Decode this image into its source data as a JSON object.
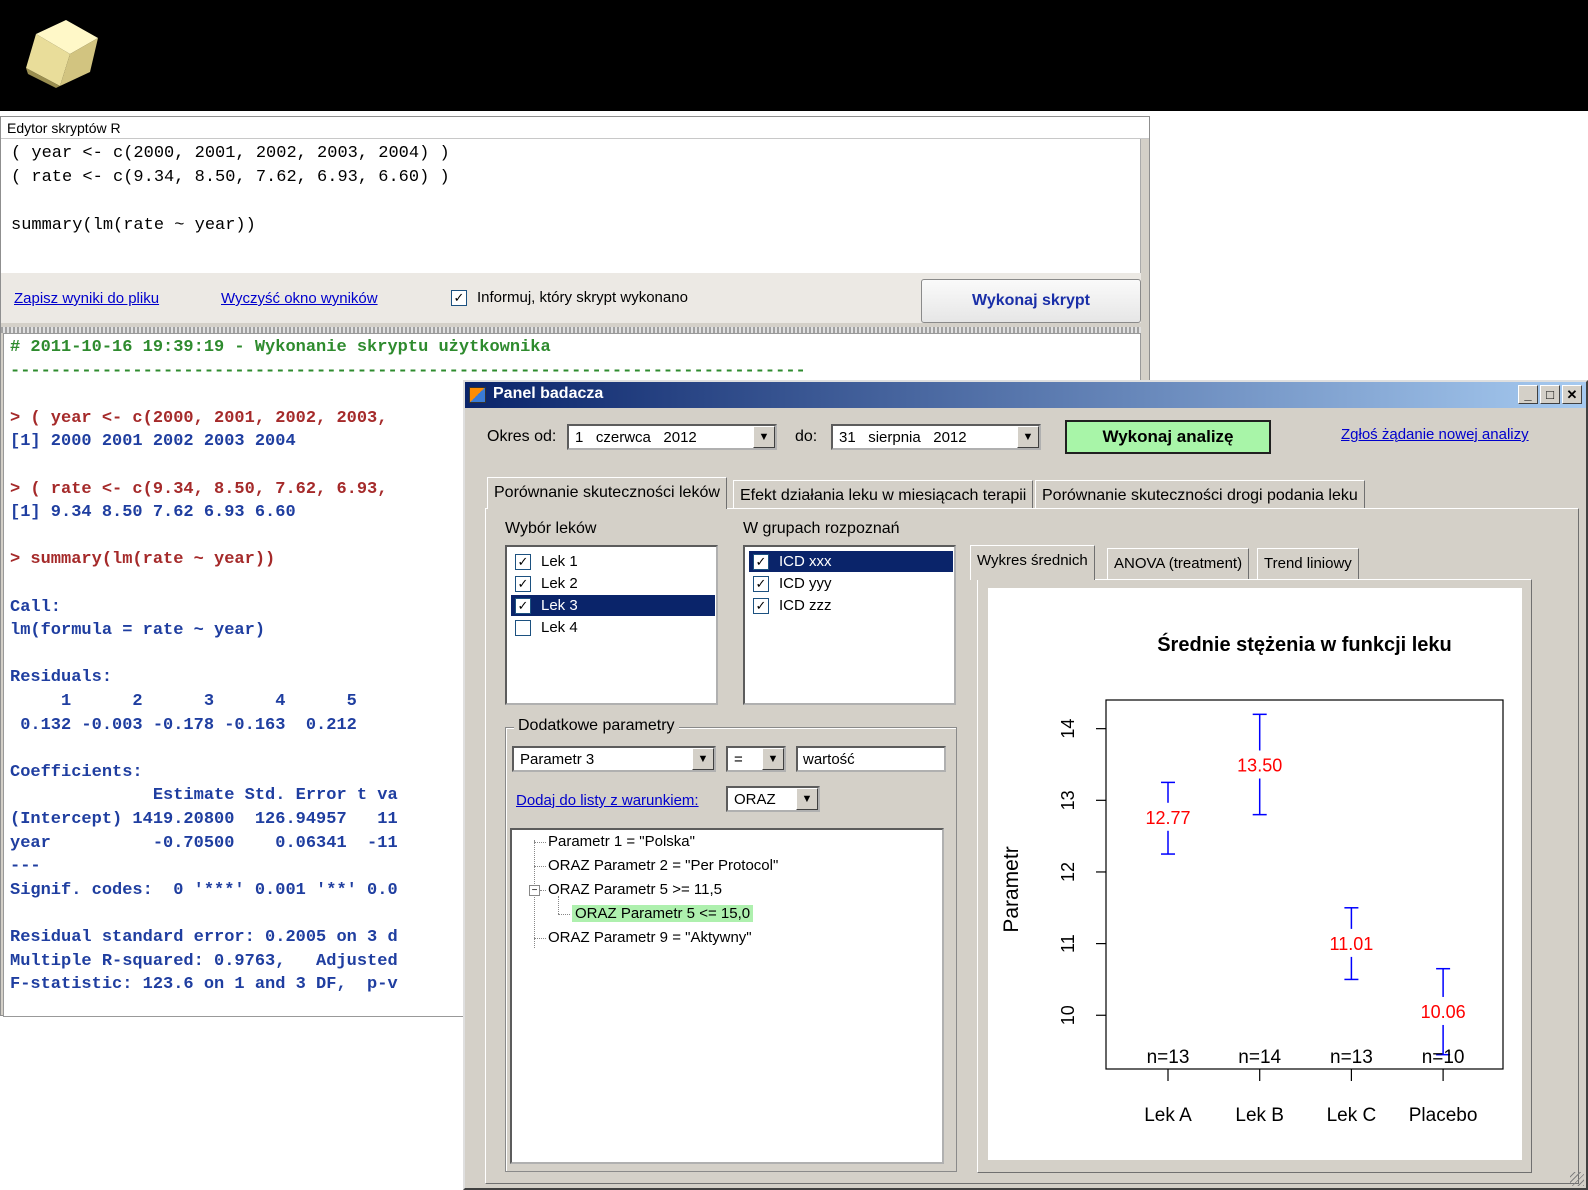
{
  "editor": {
    "title": "Edytor skryptów R",
    "code_lines": [
      "( year <- c(2000, 2001, 2002, 2003, 2004) )",
      "( rate <- c(9.34, 8.50, 7.62, 6.93, 6.60) )",
      "",
      "summary(lm(rate ~ year))"
    ],
    "save_link": "Zapisz wyniki do pliku",
    "clear_link": "Wyczyść okno wyników",
    "inform_checkbox": {
      "label": "Informuj, który skrypt wykonano",
      "checked": true
    },
    "run_button": "Wykonaj skrypt",
    "output_lines": [
      {
        "text": "# 2011-10-16 19:39:19 - Wykonanie skryptu użytkownika",
        "color": "green"
      },
      {
        "text": "------------------------------------------------------------------------------",
        "color": "green"
      },
      {
        "text": "",
        "color": "blue"
      },
      {
        "text": "> ( year <- c(2000, 2001, 2002, 2003,",
        "color": "red"
      },
      {
        "text": "[1] 2000 2001 2002 2003 2004",
        "color": "blue"
      },
      {
        "text": "",
        "color": "blue"
      },
      {
        "text": "> ( rate <- c(9.34, 8.50, 7.62, 6.93,",
        "color": "red"
      },
      {
        "text": "[1] 9.34 8.50 7.62 6.93 6.60",
        "color": "blue"
      },
      {
        "text": "",
        "color": "blue"
      },
      {
        "text": "> summary(lm(rate ~ year))",
        "color": "red"
      },
      {
        "text": "",
        "color": "blue"
      },
      {
        "text": "Call:",
        "color": "blue"
      },
      {
        "text": "lm(formula = rate ~ year)",
        "color": "blue"
      },
      {
        "text": "",
        "color": "blue"
      },
      {
        "text": "Residuals:",
        "color": "blue"
      },
      {
        "text": "     1      2      3      4      5",
        "color": "blue"
      },
      {
        "text": " 0.132 -0.003 -0.178 -0.163  0.212",
        "color": "blue"
      },
      {
        "text": "",
        "color": "blue"
      },
      {
        "text": "Coefficients:",
        "color": "blue"
      },
      {
        "text": "              Estimate Std. Error t va",
        "color": "blue"
      },
      {
        "text": "(Intercept) 1419.20800  126.94957   11",
        "color": "blue"
      },
      {
        "text": "year          -0.70500    0.06341  -11",
        "color": "blue"
      },
      {
        "text": "---",
        "color": "blue"
      },
      {
        "text": "Signif. codes:  0 '***' 0.001 '**' 0.0",
        "color": "blue"
      },
      {
        "text": "",
        "color": "blue"
      },
      {
        "text": "Residual standard error: 0.2005 on 3 d",
        "color": "blue"
      },
      {
        "text": "Multiple R-squared: 0.9763,   Adjusted",
        "color": "blue"
      },
      {
        "text": "F-statistic: 123.6 on 1 and 3 DF,  p-v",
        "color": "blue"
      }
    ]
  },
  "panel": {
    "title": "Panel badacza",
    "window_buttons": {
      "minimize": "_",
      "maximize": "□",
      "close": "✕"
    },
    "period_from_label": "Okres od:",
    "period_from": {
      "day": "1",
      "month": "czerwca",
      "year": "2012"
    },
    "period_to_label": "do:",
    "period_to": {
      "day": "31",
      "month": "sierpnia",
      "year": "2012"
    },
    "analyze_button": "Wykonaj analizę",
    "request_link": "Zgłoś żądanie nowej analizy",
    "tabs": [
      "Porównanie skuteczności leków",
      "Efekt działania leku w miesiącach terapii",
      "Porównanie skuteczności drogi podania leku"
    ],
    "drug_selection_label": "Wybór leków",
    "drugs": [
      {
        "label": "Lek 1",
        "checked": true,
        "selected": false
      },
      {
        "label": "Lek 2",
        "checked": true,
        "selected": false
      },
      {
        "label": "Lek 3",
        "checked": true,
        "selected": true
      },
      {
        "label": "Lek 4",
        "checked": false,
        "selected": false
      }
    ],
    "diagnosis_label": "W grupach rozpoznań",
    "diagnoses": [
      {
        "label": "ICD xxx",
        "checked": true,
        "selected": true
      },
      {
        "label": "ICD yyy",
        "checked": true,
        "selected": false
      },
      {
        "label": "ICD zzz",
        "checked": true,
        "selected": false
      }
    ],
    "extra_params": {
      "title": "Dodatkowe parametry",
      "param_select": "Parametr 3",
      "operator_select": "=",
      "value_field": "wartość",
      "add_link": "Dodaj do listy z warunkiem:",
      "condition_select": "ORAZ",
      "tree": [
        "Parametr 1 = \"Polska\"",
        "ORAZ  Parametr 2 = \"Per Protocol\"",
        "ORAZ Parametr 5 >= 11,5",
        "ORAZ Parametr 5 <= 15,0",
        "ORAZ Parametr 9 = \"Aktywny\""
      ],
      "expander": "−"
    },
    "inner_tabs": [
      "Wykres średnich",
      "ANOVA (treatment)",
      "Trend liniowy"
    ],
    "chart_data": {
      "type": "scatter",
      "title": "Średnie stężenia w funkcji leku",
      "ylabel": "Parametr",
      "xlabel": "",
      "categories": [
        "Lek A",
        "Lek B",
        "Lek C",
        "Placebo"
      ],
      "means": [
        12.77,
        13.5,
        11.01,
        10.06
      ],
      "mean_labels": [
        "12.77",
        "13.50",
        "11.01",
        "10.06"
      ],
      "ci_low": [
        12.25,
        12.8,
        10.5,
        9.45
      ],
      "ci_high": [
        13.25,
        14.2,
        11.5,
        10.65
      ],
      "n_labels": [
        "n=13",
        "n=14",
        "n=13",
        "n=10"
      ],
      "yticks": [
        10,
        11,
        12,
        13,
        14
      ],
      "ytick_labels": [
        "10",
        "11",
        "12",
        "13",
        "14"
      ],
      "ylim": [
        9.25,
        14.4
      ],
      "grid": false,
      "colors": {
        "error_bars": "#0000ff",
        "mean_labels": "#ff0000",
        "axis": "#000000"
      }
    }
  }
}
